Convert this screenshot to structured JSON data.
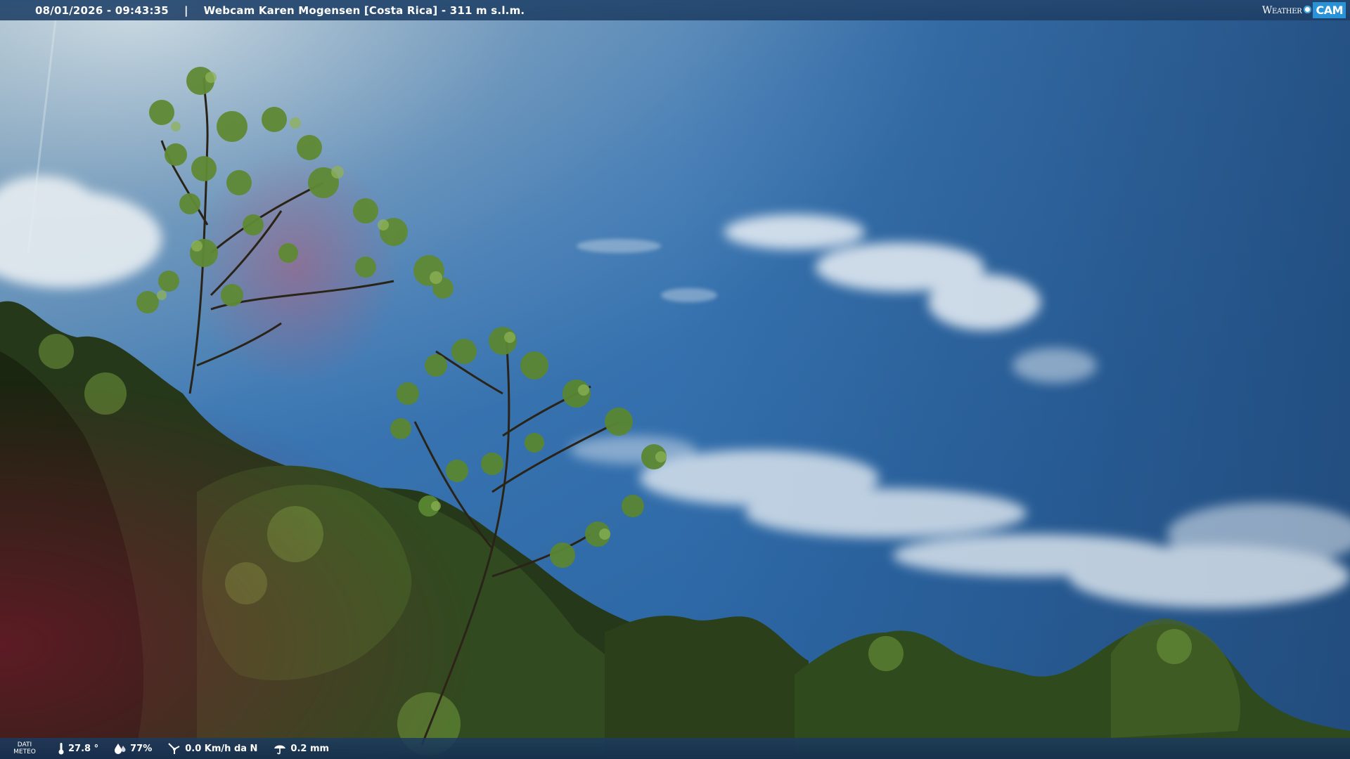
{
  "header": {
    "datetime": "08/01/2026 - 09:43:35",
    "separator": "|",
    "title": "Webcam Karen Mogensen [Costa Rica]  - 311 m s.l.m.",
    "logo_weather": "Weather",
    "logo_cam": "CAM"
  },
  "meteo": {
    "label": "DATI METEO",
    "temperature": "27.8 °",
    "humidity": "77%",
    "wind": "0.0 Km/h da N",
    "rain": "0.2 mm",
    "icons": [
      "thermometer-icon",
      "humidity-icon",
      "wind-icon",
      "rain-icon"
    ]
  },
  "colors": {
    "sky_top": "#5a7aa0",
    "sky_mid": "#2f6aa6",
    "sky_right": "#1f4c80",
    "foliage_dark": "#1f2c12",
    "foliage_mid": "#3f6224",
    "foliage_light": "#7ea445"
  }
}
